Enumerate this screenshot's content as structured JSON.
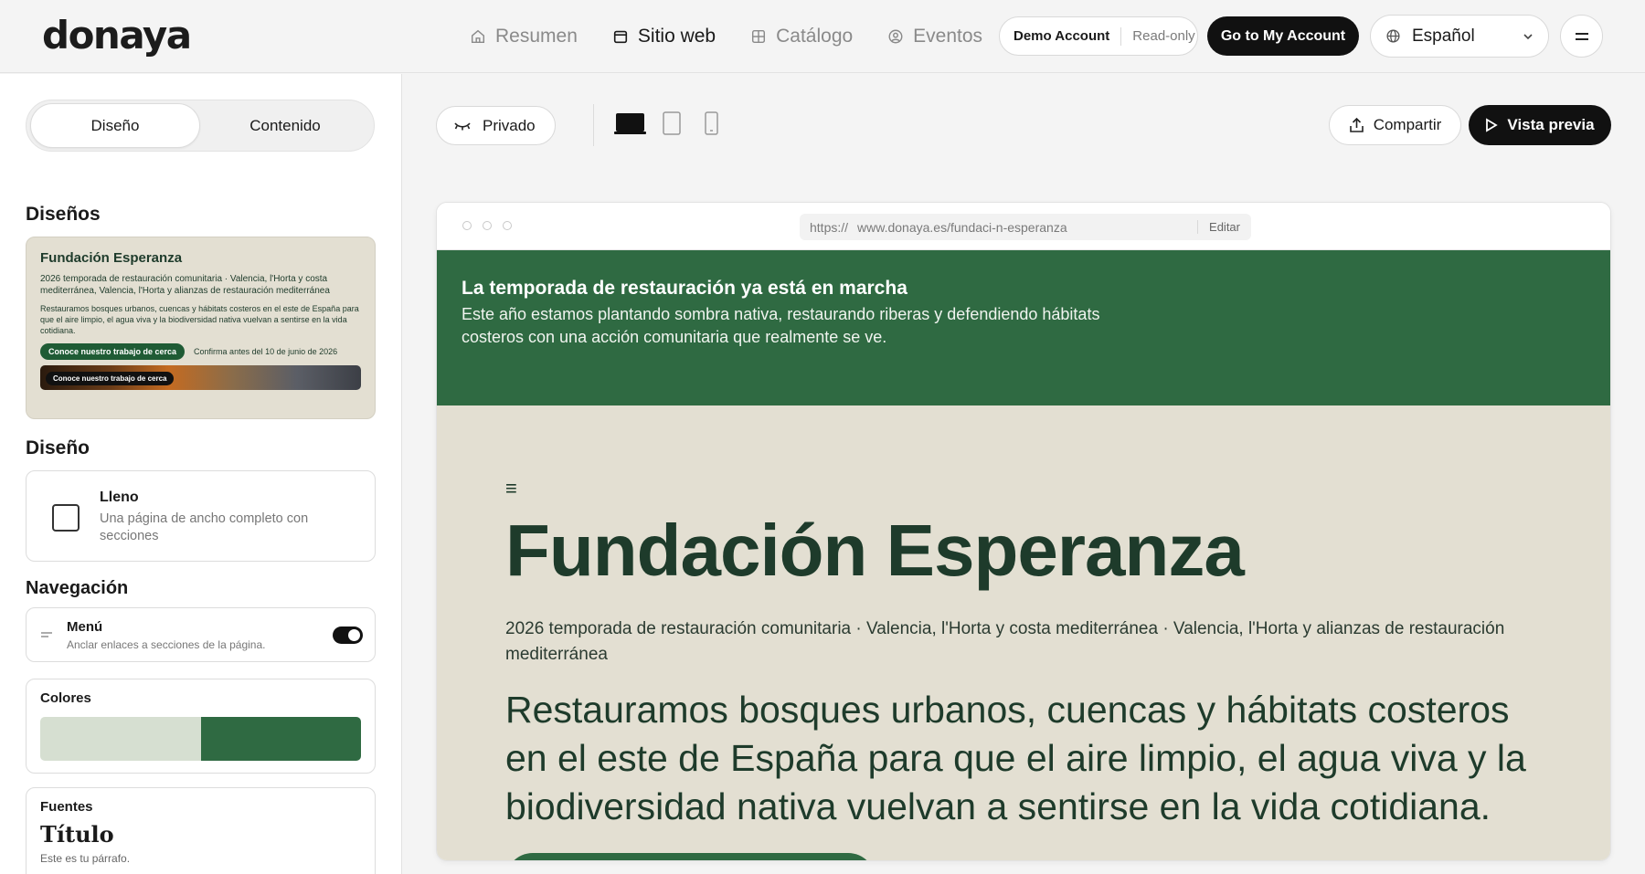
{
  "brand": "donaya",
  "nav": [
    {
      "label": "Resumen",
      "icon": "home-icon"
    },
    {
      "label": "Sitio web",
      "icon": "window-icon"
    },
    {
      "label": "Catálogo",
      "icon": "grid-icon"
    },
    {
      "label": "Eventos",
      "icon": "user-circle-icon"
    }
  ],
  "account": {
    "name": "Demo Account",
    "mode": "Read-only",
    "button": "Go to My Account"
  },
  "language": {
    "selected": "Español"
  },
  "left": {
    "tabs": {
      "active": "Diseño",
      "other": "Contenido"
    },
    "designs_title": "Diseños",
    "thumbnail": {
      "title": "Fundación Esperanza",
      "subtitle": "2026 temporada de restauración comunitaria · Valencia, l'Horta y costa mediterránea, Valencia, l'Horta y alianzas de restauración mediterránea",
      "body": "Restauramos bosques urbanos, cuencas y hábitats costeros en el este de España para que el aire limpio, el agua viva y la biodiversidad nativa vuelvan a sentirse en la vida cotidiana.",
      "cta": "Conoce nuestro trabajo de cerca",
      "deadline": "Confirma antes del 10 de junio de 2026",
      "banner_cta": "Conoce nuestro trabajo de cerca"
    },
    "layout_title": "Diseño",
    "layout": {
      "name": "Lleno",
      "desc": "Una página de ancho completo con secciones"
    },
    "navigation_title": "Navegación",
    "menu": {
      "name": "Menú",
      "desc": "Anclar enlaces a secciones de la página.",
      "enabled": true
    },
    "colors": {
      "title": "Colores",
      "swatches": [
        "#d6dfd1",
        "#2f6a42"
      ]
    },
    "fonts": {
      "title": "Fuentes",
      "heading": "Título",
      "paragraph": "Este es tu párrafo."
    }
  },
  "toolbar": {
    "privacy": "Privado",
    "share": "Compartir",
    "preview": "Vista previa",
    "devices": [
      "desktop-icon",
      "tablet-icon",
      "mobile-icon"
    ]
  },
  "browser": {
    "scheme": "https://",
    "host": "www.donaya.es/fundaci-n-esperanza",
    "edit": "Editar"
  },
  "site": {
    "band_title": "La temporada de restauración ya está en marcha",
    "band_text": "Este año estamos plantando sombra nativa, restaurando riberas y defendiendo hábitats costeros con una acción comunitaria que realmente se ve.",
    "title": "Fundación Esperanza",
    "subtitle": "2026 temporada de restauración comunitaria · Valencia, l'Horta y costa mediterránea · Valencia, l'Horta y alianzas de restauración mediterránea",
    "lead": "Restauramos bosques urbanos, cuencas y hábitats costeros en el este de España para que el aire limpio, el agua viva y la biodiversidad nativa vuelvan a sentirse en la vida cotidiana."
  }
}
